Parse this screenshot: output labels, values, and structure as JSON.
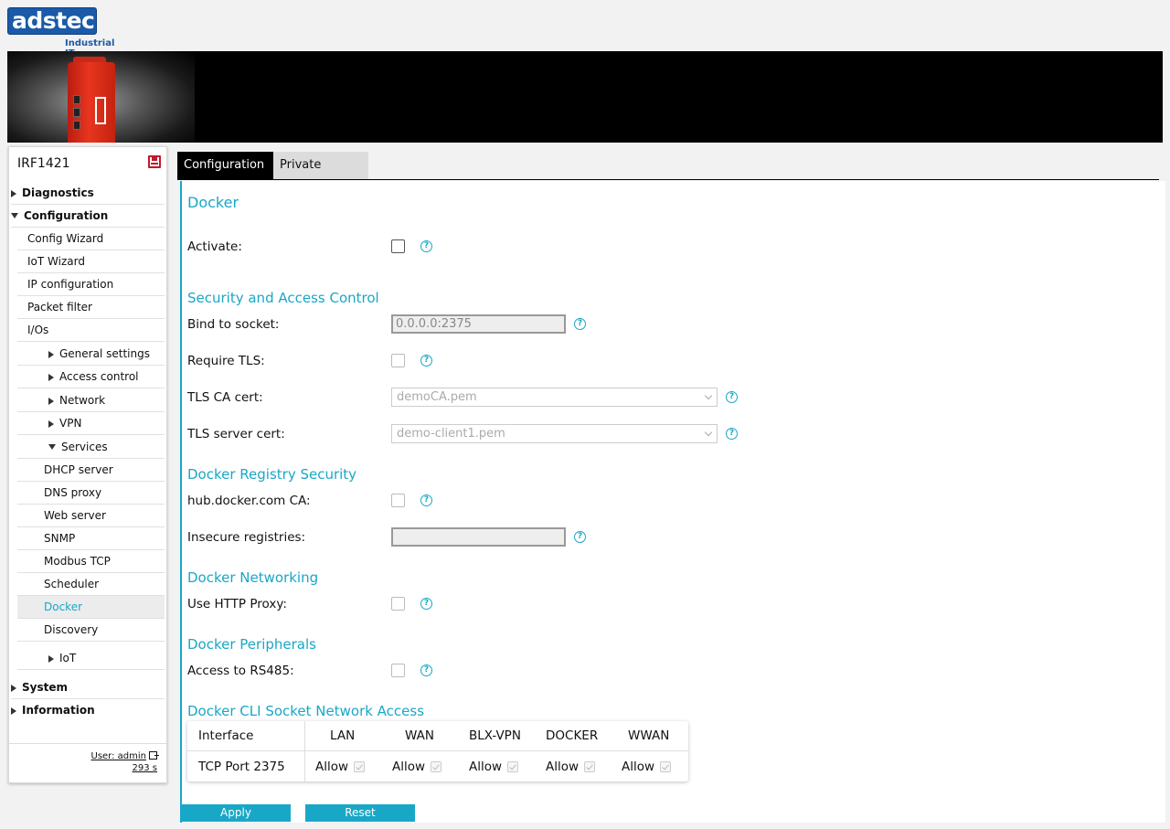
{
  "brand": {
    "logo_text": "adstec",
    "tagline": "Industrial IT",
    "colors": {
      "brand_blue": "#1a5aa8",
      "accent": "#19a7c7",
      "save_red": "#c2182b"
    }
  },
  "sidebar": {
    "device_name": "IRF1421",
    "items": [
      {
        "label": "Diagnostics"
      },
      {
        "label": "Configuration"
      },
      {
        "label": "Config Wizard"
      },
      {
        "label": "IoT Wizard"
      },
      {
        "label": "IP configuration"
      },
      {
        "label": "Packet filter"
      },
      {
        "label": "I/Os"
      },
      {
        "label": "General settings"
      },
      {
        "label": "Access control"
      },
      {
        "label": "Network"
      },
      {
        "label": "VPN"
      },
      {
        "label": "Services"
      },
      {
        "label": "DHCP server"
      },
      {
        "label": "DNS proxy"
      },
      {
        "label": "Web server"
      },
      {
        "label": "SNMP"
      },
      {
        "label": "Modbus TCP"
      },
      {
        "label": "Scheduler"
      },
      {
        "label": "Docker"
      },
      {
        "label": "Discovery"
      },
      {
        "label": "IoT"
      },
      {
        "label": "System"
      },
      {
        "label": "Information"
      }
    ],
    "active_item": "Docker",
    "user": "User: admin",
    "session": "293 s"
  },
  "tabs": [
    {
      "label": "Configuration"
    },
    {
      "label": "Private registry"
    }
  ],
  "sections": {
    "docker": "Docker",
    "security": "Security and Access Control",
    "registry": "Docker Registry Security",
    "networking": "Docker Networking",
    "peripherals": "Docker Peripherals",
    "cli": "Docker CLI Socket Network Access"
  },
  "fields": {
    "activate": {
      "label": "Activate:",
      "checked": false
    },
    "bind_socket": {
      "label": "Bind to socket:",
      "value": "0.0.0.0:2375"
    },
    "require_tls": {
      "label": "Require TLS:",
      "checked": false
    },
    "tls_ca": {
      "label": "TLS CA cert:",
      "value": "demoCA.pem"
    },
    "tls_server": {
      "label": "TLS server cert:",
      "value": "demo-client1.pem"
    },
    "hub_ca": {
      "label": "hub.docker.com CA:",
      "checked": false
    },
    "insecure": {
      "label": "Insecure registries:",
      "value": ""
    },
    "http_proxy": {
      "label": "Use HTTP Proxy:",
      "checked": false
    },
    "rs485": {
      "label": "Access to RS485:",
      "checked": false
    }
  },
  "cli_table": {
    "headers": [
      "Interface",
      "LAN",
      "WAN",
      "BLX-VPN",
      "DOCKER",
      "WWAN"
    ],
    "row": {
      "name": "TCP Port 2375",
      "cells": [
        "Allow",
        "Allow",
        "Allow",
        "Allow",
        "Allow"
      ]
    }
  },
  "buttons": {
    "apply": "Apply",
    "reset": "Reset"
  },
  "help_glyph": "?"
}
